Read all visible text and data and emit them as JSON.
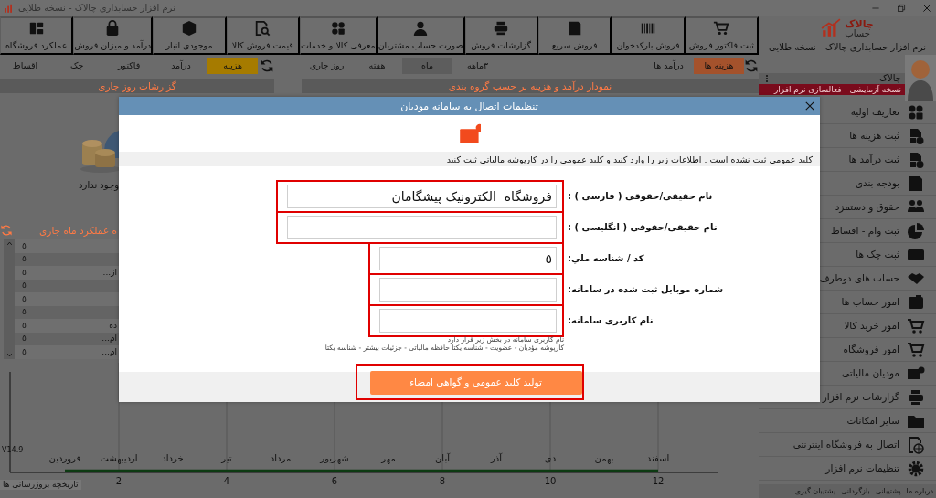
{
  "window": {
    "title": "نرم افزار حسابداری چالاک - نسخه طلایی"
  },
  "logo": {
    "line_1": "چالاک",
    "line_2": "حساب",
    "caption": "نرم افزار حسابداری چالاک - نسخه طلایی"
  },
  "toolbar": [
    {
      "label": "ثبت فاکتور فروش"
    },
    {
      "label": "فروش بارکدخوان"
    },
    {
      "label": "فروش سریع"
    },
    {
      "label": "گزارشات فروش"
    },
    {
      "label": "صورت حساب مشتریان"
    },
    {
      "label": "معرفی کالا و خدمات"
    },
    {
      "label": "قیمت فروش کالا"
    },
    {
      "label": "موجودی انبار"
    },
    {
      "label": "درآمد و میزان فروش"
    },
    {
      "label": "عملکرد فروشگاه"
    }
  ],
  "chart_panel": {
    "tabs": [
      {
        "label": "هزینه ها",
        "selected": true
      },
      {
        "label": "درآمد ها",
        "selected": false
      }
    ],
    "periods": [
      {
        "label": "۳ماهه",
        "selected": false
      },
      {
        "label": "ماه",
        "selected": true
      },
      {
        "label": "هفته",
        "selected": false
      },
      {
        "label": "روز جاری",
        "selected": false
      }
    ],
    "title": "نمودار درآمد و هزینه بر حسب گروه بندی"
  },
  "daily_panel": {
    "tabs": [
      {
        "label": "هزینه",
        "selected": true
      },
      {
        "label": "درآمد",
        "selected": false
      },
      {
        "label": "فاکتور",
        "selected": false
      },
      {
        "label": "چک",
        "selected": false
      },
      {
        "label": "اقساط",
        "selected": false
      }
    ],
    "title": "گزارشات روز جاری",
    "empty_text": "وجود ندارد"
  },
  "monthly_panel": {
    "title": "ه عملکرد ماه جاری",
    "rows": [
      {
        "value": "٥"
      },
      {
        "value": "٥"
      },
      {
        "label": "از...",
        "value": "٥"
      },
      {
        "value": "٥"
      },
      {
        "value": "٥"
      },
      {
        "value": "٥"
      },
      {
        "label": "ده",
        "value": "٥"
      },
      {
        "label": "ام...",
        "value": "٥"
      },
      {
        "label": "ام...",
        "value": "٥"
      }
    ]
  },
  "user": {
    "name": "چالاک",
    "trial_notice": "نسخه آزمایشی - فعالسازی نرم افزار"
  },
  "sidebar": {
    "items": [
      {
        "label": "تعاریف اولیه"
      },
      {
        "label": "ثبت هزینه ها"
      },
      {
        "label": "ثبت درآمد ها"
      },
      {
        "label": "بودجه بندی"
      },
      {
        "label": "حقوق و دستمزد"
      },
      {
        "label": "ثبت وام - اقساط"
      },
      {
        "label": "ثبت چک ها"
      },
      {
        "label": "حساب های دوطرف"
      },
      {
        "label": "امور حساب ها"
      },
      {
        "label": "امور خرید کالا"
      },
      {
        "label": "امور فروشگاه"
      },
      {
        "label": "مودیان مالیاتی"
      },
      {
        "label": "گزارشات نرم افزار"
      },
      {
        "label": "سایر امکانات"
      },
      {
        "label": "اتصال به فروشگاه اینترنتی"
      },
      {
        "label": "تنظیمات نرم افزار"
      }
    ]
  },
  "footer_links": [
    "درباره ما",
    "پشتیبانی",
    "بازگردانی",
    "پشتیبان گیری"
  ],
  "month_chart": {
    "months": [
      "اسفند",
      "بهمن",
      "دی",
      "آذر",
      "آبان",
      "مهر",
      "شهریور",
      "مرداد",
      "تیر",
      "خرداد",
      "اردیبهشت",
      "فروردین"
    ],
    "ticks": [
      "12",
      "10",
      "8",
      "6",
      "4",
      "2"
    ]
  },
  "version": "V14.9",
  "update_history": "تاریخچه بروزرسانی ها",
  "dialog": {
    "title": "تنظیمات اتصال به سامانه مودیان",
    "notice": "کلید عمومی ثبت نشده است . اطلاعات زیر را وارد کنید و کلید عمومی را در کارپوشه مالیاتی ثبت کنید",
    "fields": [
      {
        "label": "نام حقیقی/حقوقی ( فارسی ) :",
        "value": "فروشگاه  الکترونیک پیشگامان",
        "kind": "wide",
        "highlighted": true
      },
      {
        "label": "نام حقیقی/حقوقی ( انگلیسی ) :",
        "kind": "wide",
        "highlighted": true
      },
      {
        "label": "کد / شناسه ملي:",
        "value": "٥",
        "kind": "narrow",
        "highlighted": true
      },
      {
        "label": "شماره موبایل ثبت شده در سامانه:",
        "kind": "narrow",
        "highlighted": true
      },
      {
        "label": "نام کاربری سامانه:",
        "kind": "narrow",
        "highlighted": true
      }
    ],
    "hints": [
      "نام کاربری سامانه در بخش زیر قرار دارد",
      "کارپوشه مؤدیان - عضویت - شناسه یکتا حافظه مالیاتی - جزئیات بیشتر - شناسه یکتا"
    ],
    "button": {
      "label": "تولید کلید عمومی و گواهی امضاء",
      "highlighted": true
    }
  }
}
